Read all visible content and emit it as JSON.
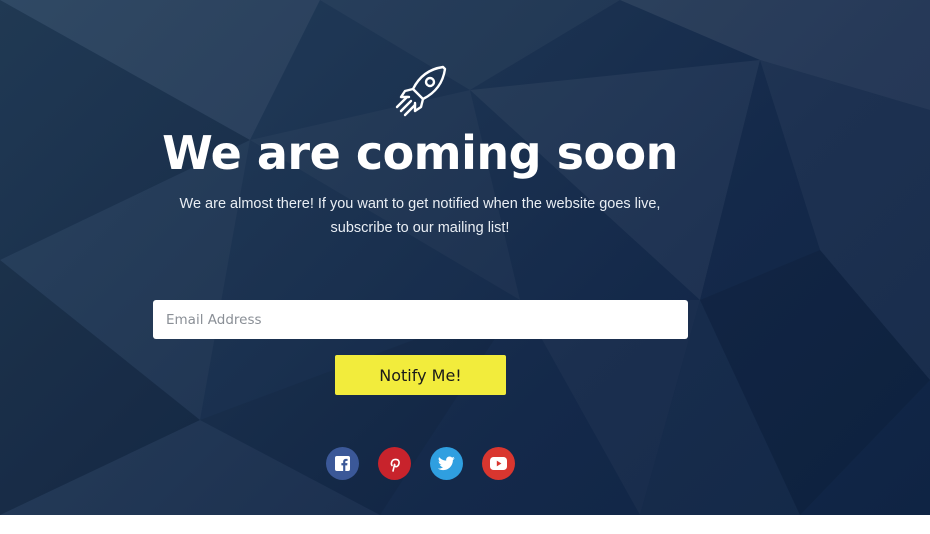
{
  "page": {
    "icon": "rocket-icon",
    "title": "We are coming soon",
    "subtitle": "We are almost there! If you want to get notified when the website goes live, subscribe to our mailing list!"
  },
  "form": {
    "email_placeholder": "Email Address",
    "email_value": "",
    "submit_label": "Notify Me!"
  },
  "social": [
    {
      "name": "facebook",
      "icon": "facebook-icon",
      "color": "#3b5898"
    },
    {
      "name": "pinterest",
      "icon": "pinterest-icon",
      "color": "#c8232c"
    },
    {
      "name": "twitter",
      "icon": "twitter-icon",
      "color": "#2f9fe0"
    },
    {
      "name": "youtube",
      "icon": "youtube-icon",
      "color": "#d9362f"
    }
  ],
  "colors": {
    "background": "#1c3351",
    "button": "#f2ec3c",
    "text": "#ffffff"
  }
}
